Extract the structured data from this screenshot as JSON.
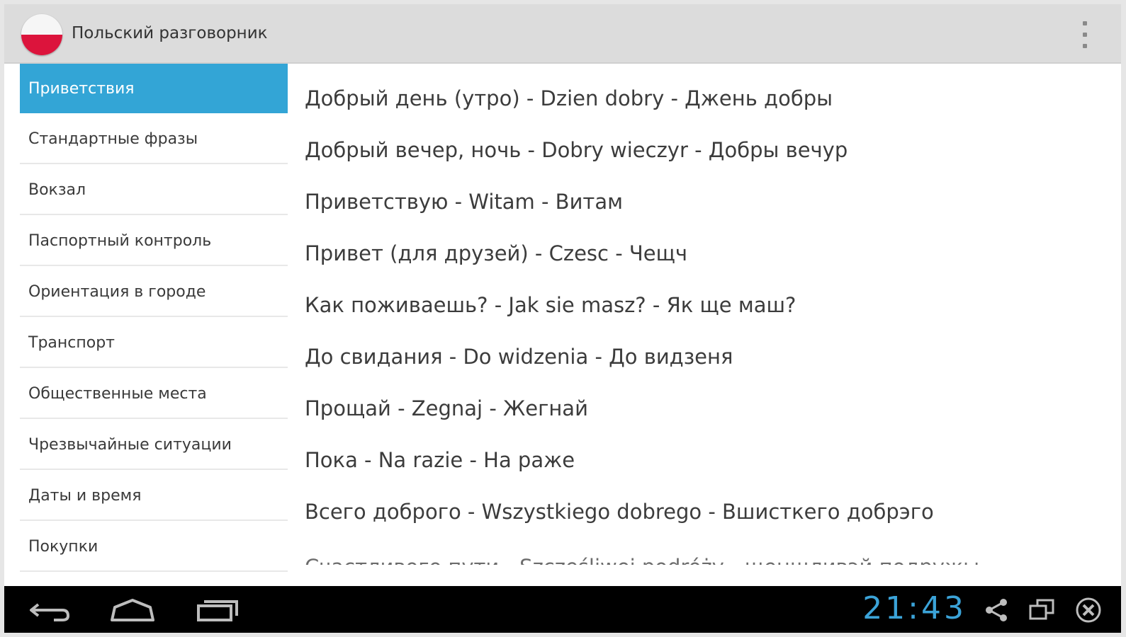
{
  "app": {
    "title": "Польский разговорник",
    "icon": "poland-flag-icon",
    "menu_icon": "overflow-menu-icon"
  },
  "sidebar": {
    "items": [
      {
        "label": "Приветствия",
        "active": true
      },
      {
        "label": "Стандартные фразы",
        "active": false
      },
      {
        "label": "Вокзал",
        "active": false
      },
      {
        "label": "Паспортный контроль",
        "active": false
      },
      {
        "label": "Ориентация в городе",
        "active": false
      },
      {
        "label": "Транспорт",
        "active": false
      },
      {
        "label": "Общественные места",
        "active": false
      },
      {
        "label": "Чрезвычайные ситуации",
        "active": false
      },
      {
        "label": "Даты и время",
        "active": false
      },
      {
        "label": "Покупки",
        "active": false
      }
    ]
  },
  "content": {
    "phrases": [
      "Добрый день (утро) - Dzien dobry - Джень добры",
      "Добрый вечер, ночь - Dobry wieczyr - Добры вечур",
      "Приветствую - Witam - Витам",
      "Привет (для друзей) - Czesc - Чещч",
      "Как поживаешь? - Jak sie masz? - Як ще маш?",
      "До свидания - Do widzenia - До видзеня",
      "Прощай - Zegnaj - Жегнай",
      "Пока - Na razie - На раже",
      "Всего доброго - Wszystkiego dobrego - Вшисткего добрэго",
      "Счастливого пути - Szczęśliwej podróży - щенщливэй подружы"
    ]
  },
  "navbar": {
    "clock": "21:43",
    "back_icon": "back-icon",
    "home_icon": "home-icon",
    "recents_icon": "recent-apps-icon",
    "share_icon": "share-icon",
    "screens_icon": "screens-icon",
    "close_icon": "close-icon"
  },
  "colors": {
    "accent": "#33a5d6",
    "action_bar": "#dcdcdc",
    "clock": "#3ba3d8",
    "flag_red": "#dc143c"
  }
}
